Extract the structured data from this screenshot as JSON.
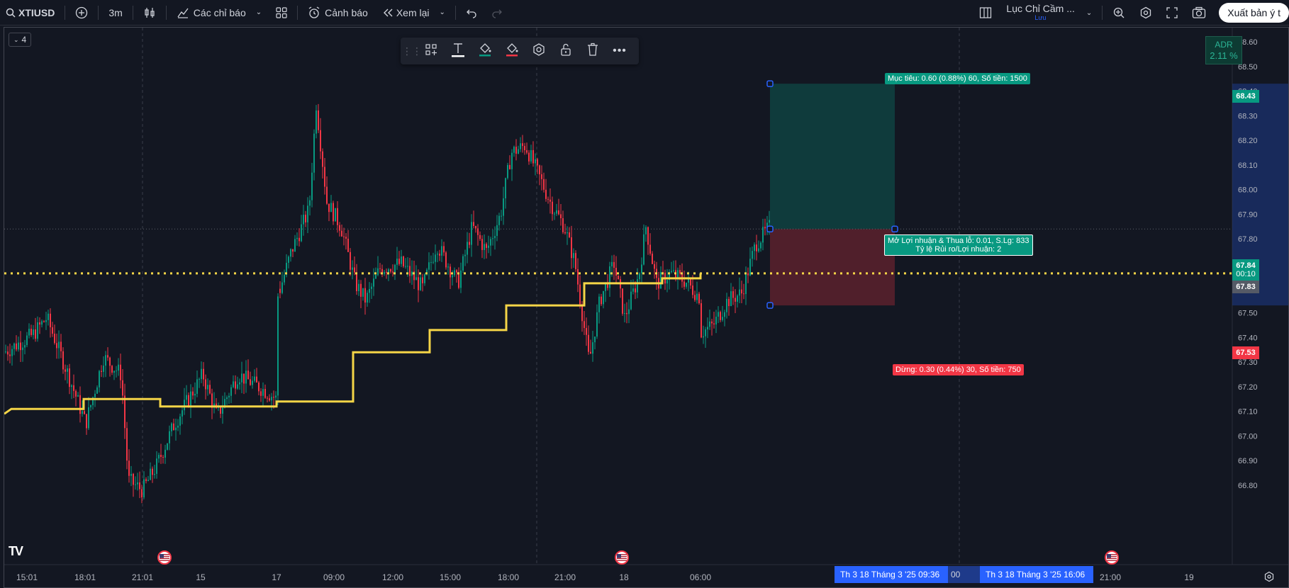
{
  "topbar": {
    "symbol": "XTIUSD",
    "interval": "3m",
    "indicators_label": "Các chỉ báo",
    "alert_label": "Cảnh báo",
    "replay_label": "Xem lại",
    "layout_name": "Lục Chỉ Cầm ...",
    "layout_sub": "Lưu",
    "publish_label": "Xuất bản ý t"
  },
  "chart": {
    "collapse_count": "4",
    "adr_label": "ADR",
    "adr_value": "2.11 %",
    "target_label": "Mục tiêu: 0.60 (0.88%) 60, Số tiền: 1500",
    "stop_label": "Dừng: 0.30 (0.44%) 30, Số tiền: 750",
    "pnl_line1": "Mở Lợi nhuận & Thua lỗ: 0.01, S.Lg: 833",
    "pnl_line2": "Tỷ lệ Rủi ro/Lợi nhuận: 2",
    "tag_target": "68.43",
    "tag_current": "67.84",
    "tag_countdown": "00:10",
    "tag_prev": "67.83",
    "tag_stop": "67.53",
    "time_tag_1": "Th 3 18 Tháng 3 '25   09:36",
    "time_tag_2": "Th 3 18 Tháng 3 '25   16:06",
    "time_tag_peek": "00",
    "tv_logo": "TV"
  },
  "chart_data": {
    "type": "candlestick",
    "y_axis": {
      "ticks": [
        "68.60",
        "68.50",
        "68.40",
        "68.30",
        "68.20",
        "68.10",
        "68.00",
        "67.90",
        "67.80",
        "67.70",
        "67.60",
        "67.50",
        "67.40",
        "67.30",
        "67.20",
        "67.10",
        "67.00",
        "66.90",
        "66.80"
      ],
      "ylim": [
        66.78,
        68.65
      ]
    },
    "x_axis": {
      "ticks": [
        "15:01",
        "18:01",
        "21:01",
        "15",
        "17",
        "09:00",
        "12:00",
        "15:00",
        "18:00",
        "21:00",
        "18",
        "06:00",
        "21:00",
        "19"
      ]
    },
    "dotted_level": 67.66,
    "step_line": [
      {
        "from": "15:01",
        "value": 67.09
      },
      {
        "value": 67.11
      },
      {
        "value": 67.15
      },
      {
        "value": 67.12
      },
      {
        "value": 67.14
      },
      {
        "value": 67.34
      },
      {
        "value": 67.43
      },
      {
        "value": 67.53
      },
      {
        "value": 67.62
      },
      {
        "value": 67.64
      }
    ],
    "position": {
      "entry": 67.84,
      "target": 68.43,
      "stop": 67.53,
      "risk_reward": 2
    },
    "colors": {
      "up": "#089981",
      "down": "#f23645",
      "step_line": "#f5d547",
      "dotted": "#f5d547"
    }
  }
}
